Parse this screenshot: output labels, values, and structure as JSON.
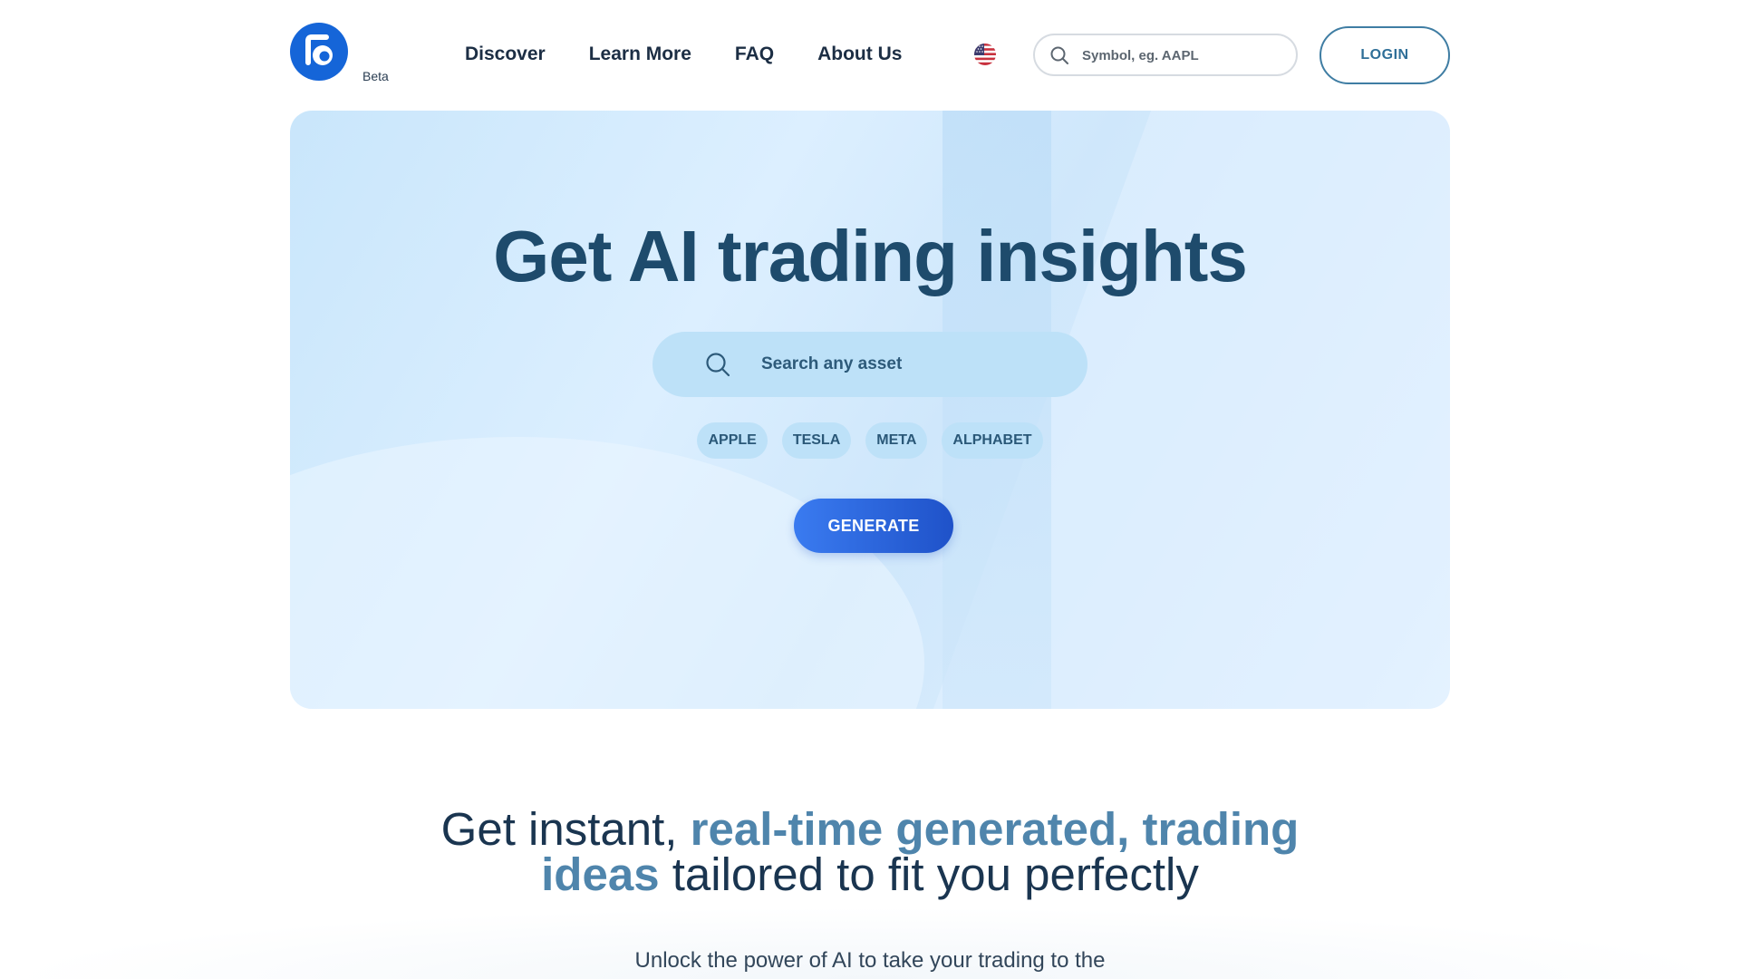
{
  "header": {
    "logo_icon": "brand-logo-icon",
    "beta_label": "Beta",
    "nav": [
      {
        "label": "Discover"
      },
      {
        "label": "Learn More"
      },
      {
        "label": "FAQ"
      },
      {
        "label": "About Us"
      }
    ],
    "language_icon": "us-flag-icon",
    "search": {
      "placeholder": "Symbol, eg. AAPL",
      "value": ""
    },
    "login_label": "LOGIN"
  },
  "hero": {
    "title": "Get AI trading insights",
    "search": {
      "placeholder": "Search any asset",
      "value": ""
    },
    "chips": [
      {
        "label": "APPLE"
      },
      {
        "label": "TESLA"
      },
      {
        "label": "META"
      },
      {
        "label": "ALPHABET"
      }
    ],
    "generate_label": "GENERATE"
  },
  "section": {
    "tagline_part1": "Get instant, ",
    "tagline_highlight1": "real-time generated, trading",
    "tagline_highlight2": "ideas",
    "tagline_part2": " tailored to fit you perfectly",
    "subtext_line1": "Unlock the power of AI to take your trading to the"
  },
  "colors": {
    "brand_blue": "#1565d8",
    "heading": "#1e4b6c",
    "accent_text": "#4f85ac",
    "hero_bg": "#d6ecfc"
  }
}
